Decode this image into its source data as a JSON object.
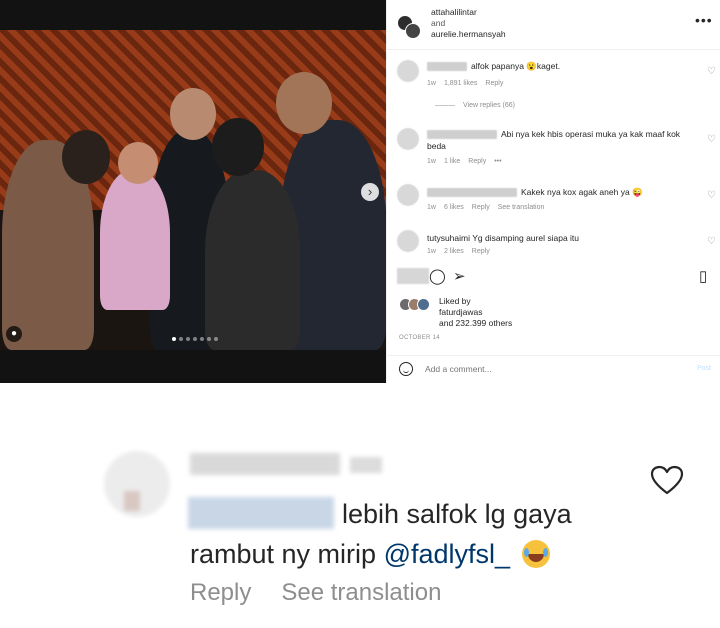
{
  "post": {
    "header": {
      "account1": "attahalilintar",
      "joiner": "and",
      "account2": "aurelie.hermansyah",
      "more_icon": "more-horizontal-icon"
    },
    "comments": [
      {
        "text_visible": "alfok papanya",
        "text_after_emoji": "kaget.",
        "emoji": "😮",
        "time": "1w",
        "likes": "1,891 likes",
        "reply": "Reply",
        "view_replies": "View replies (66)"
      },
      {
        "text_visible": "Abi nya kek hbis operasi muka ya kak maaf kok beda",
        "time": "1w",
        "likes": "1 like",
        "reply": "Reply",
        "more": "•••"
      },
      {
        "text_visible": "Kakek nya kox agak aneh ya",
        "emoji": "😜",
        "time": "1w",
        "likes": "6 likes",
        "reply": "Reply",
        "see_translation": "See translation"
      },
      {
        "username": "tutysuhaimi",
        "text_visible": "Yg disamping aurel siapa itu",
        "time": "1w",
        "likes": "2 likes",
        "reply": "Reply"
      }
    ],
    "liked_by": {
      "label": "Liked by",
      "user": "faturdjawas",
      "others": "and 232.399 others"
    },
    "date": "OCTOBER 14",
    "add_comment_placeholder": "Add a comment...",
    "post_button": "Post",
    "carousel": {
      "slides": 7,
      "active_index": 0
    }
  },
  "zoom_comment": {
    "text_visible": "lebih salfok lg gaya rambut ny mirip",
    "mention": "@fadlyfsl_",
    "emoji": "😂",
    "reply": "Reply",
    "see_translation": "See translation",
    "heart_icon": "heart-outline-icon"
  },
  "colors": {
    "text": "#262626",
    "meta": "#8e8e8e",
    "mention": "#00376b",
    "post_button": "#c0dffd"
  }
}
